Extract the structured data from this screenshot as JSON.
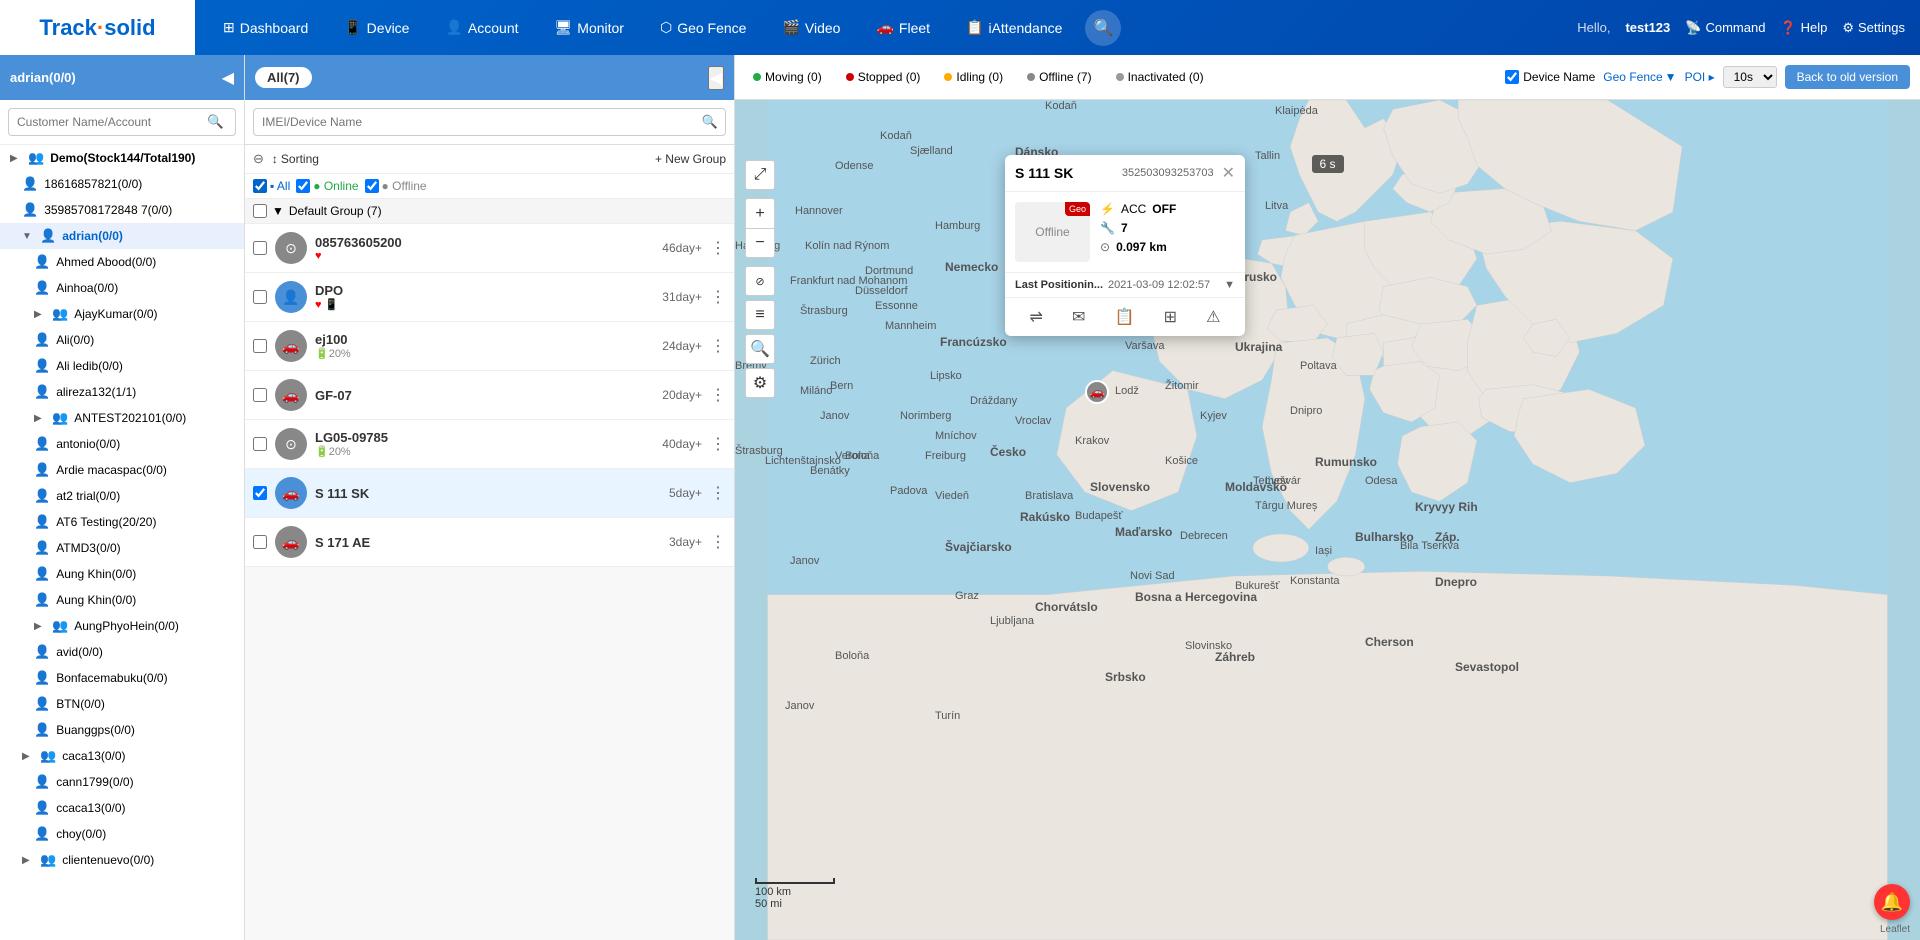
{
  "app": {
    "logo": "Track solid",
    "logo_dot": "·"
  },
  "nav": {
    "items": [
      {
        "label": "Dashboard",
        "icon": "⊞"
      },
      {
        "label": "Device",
        "icon": "📱"
      },
      {
        "label": "Account",
        "icon": "👤"
      },
      {
        "label": "Monitor",
        "icon": "🖥"
      },
      {
        "label": "Geo Fence",
        "icon": "⬡"
      },
      {
        "label": "Video",
        "icon": "🎬"
      },
      {
        "label": "Fleet",
        "icon": "🚗"
      },
      {
        "label": "iAttendance",
        "icon": "📋"
      }
    ],
    "hello": "Hello,",
    "user": "test123",
    "command": "Command",
    "help": "Help",
    "settings": "Settings"
  },
  "sidebar": {
    "header": "adrian(0/0)",
    "search_placeholder": "Customer Name/Account",
    "tree": [
      {
        "label": "Demo(Stock144/Total190)",
        "icon": "▶",
        "type": "group",
        "indent": 0
      },
      {
        "label": "18616857821(0/0)",
        "icon": "",
        "type": "user",
        "indent": 1
      },
      {
        "label": "35985708172848 7(0/0)",
        "icon": "",
        "type": "user",
        "indent": 1
      },
      {
        "label": "adrian(0/0)",
        "icon": "▼",
        "type": "user",
        "indent": 1,
        "active": true
      },
      {
        "label": "Ahmed Abood(0/0)",
        "icon": "",
        "type": "user",
        "indent": 2
      },
      {
        "label": "Ainhoa(0/0)",
        "icon": "",
        "type": "user",
        "indent": 2
      },
      {
        "label": "AjayKumar(0/0)",
        "icon": "▶",
        "type": "group",
        "indent": 2
      },
      {
        "label": "Ali(0/0)",
        "icon": "",
        "type": "user",
        "indent": 2
      },
      {
        "label": "Ali ledib(0/0)",
        "icon": "",
        "type": "user",
        "indent": 2
      },
      {
        "label": "alireza132(1/1)",
        "icon": "",
        "type": "user",
        "indent": 2
      },
      {
        "label": "ANTEST202101(0/0)",
        "icon": "▶",
        "type": "group",
        "indent": 2
      },
      {
        "label": "antonio(0/0)",
        "icon": "",
        "type": "user",
        "indent": 2
      },
      {
        "label": "Ardie macaspac(0/0)",
        "icon": "",
        "type": "user",
        "indent": 2
      },
      {
        "label": "at2 trial(0/0)",
        "icon": "",
        "type": "user",
        "indent": 2
      },
      {
        "label": "AT6 Testing(20/20)",
        "icon": "",
        "type": "user",
        "indent": 2
      },
      {
        "label": "ATMD3(0/0)",
        "icon": "",
        "type": "user",
        "indent": 2
      },
      {
        "label": "Aung Khin(0/0)",
        "icon": "",
        "type": "user",
        "indent": 2
      },
      {
        "label": "Aung Khin(0/0)",
        "icon": "",
        "type": "user",
        "indent": 2
      },
      {
        "label": "AungPhyoHein(0/0)",
        "icon": "▶",
        "type": "group",
        "indent": 2
      },
      {
        "label": "avid(0/0)",
        "icon": "",
        "type": "user",
        "indent": 2
      },
      {
        "label": "Bonfacemabuku(0/0)",
        "icon": "",
        "type": "user",
        "indent": 2
      },
      {
        "label": "BTN(0/0)",
        "icon": "",
        "type": "user",
        "indent": 2
      },
      {
        "label": "Buanggps(0/0)",
        "icon": "",
        "type": "user",
        "indent": 2
      },
      {
        "label": "caca13(0/0)",
        "icon": "▶",
        "type": "group",
        "indent": 1
      },
      {
        "label": "cann1799(0/0)",
        "icon": "",
        "type": "user",
        "indent": 2
      },
      {
        "label": "ccaca13(0/0)",
        "icon": "",
        "type": "user",
        "indent": 2
      },
      {
        "label": "choy(0/0)",
        "icon": "",
        "type": "user",
        "indent": 2
      },
      {
        "label": "clientenuevo(0/0)",
        "icon": "▶",
        "type": "group",
        "indent": 1
      }
    ]
  },
  "middle": {
    "all_label": "All(7)",
    "search_placeholder": "IMEI/Device Name",
    "sorting_label": "Sorting",
    "new_group_label": "+ New Group",
    "filters": [
      {
        "label": "All",
        "checked": true,
        "color": "blue"
      },
      {
        "label": "Online",
        "checked": true,
        "color": "green"
      },
      {
        "label": "Offline",
        "checked": true,
        "color": "gray"
      }
    ],
    "group_label": "Default Group (7)",
    "devices": [
      {
        "name": "085763605200",
        "days": "46day+",
        "heart": true,
        "phone": false,
        "battery": "",
        "type": "circle"
      },
      {
        "name": "DPO",
        "days": "31day+",
        "heart": true,
        "phone": true,
        "battery": "",
        "type": "user"
      },
      {
        "name": "ej100",
        "days": "24day+",
        "heart": false,
        "phone": false,
        "battery": "20%",
        "type": "car"
      },
      {
        "name": "GF-07",
        "days": "20day+",
        "heart": false,
        "phone": false,
        "battery": "",
        "type": "car"
      },
      {
        "name": "LG05-09785",
        "days": "40day+",
        "heart": false,
        "phone": false,
        "battery": "20%",
        "type": "circle"
      },
      {
        "name": "S 111 SK",
        "days": "5day+",
        "heart": false,
        "phone": false,
        "battery": "",
        "type": "car",
        "selected": true
      },
      {
        "name": "S 171 AE",
        "days": "3day+",
        "heart": false,
        "phone": false,
        "battery": "",
        "type": "car"
      }
    ]
  },
  "map_toolbar": {
    "statuses": [
      {
        "label": "Moving (0)",
        "color": "moving"
      },
      {
        "label": "Stopped (0)",
        "color": "stopped"
      },
      {
        "label": "Idling (0)",
        "color": "idling"
      },
      {
        "label": "Offline (7)",
        "color": "offline"
      },
      {
        "label": "Inactivated (0)",
        "color": "inactive"
      }
    ],
    "device_name_label": "Device Name",
    "geo_fence_label": "Geo Fence",
    "geo_fence_arrow": "▼",
    "poi_label": "POI",
    "poi_arrow": "▸",
    "interval": "10s",
    "back_old": "Back to old version",
    "timer": "6 s"
  },
  "popup": {
    "title": "S 111 SK",
    "id": "352503093253703",
    "status": "Offline",
    "geo_badge": "Geo",
    "acc": "OFF",
    "relay": "7",
    "mileage": "0.097 km",
    "last_pos_label": "Last Positionin...",
    "last_pos_time": "2021-03-09 12:02:57"
  },
  "map_scale": {
    "km": "100 km",
    "mi": "50 mi"
  },
  "map_attribution": "Leaflet"
}
